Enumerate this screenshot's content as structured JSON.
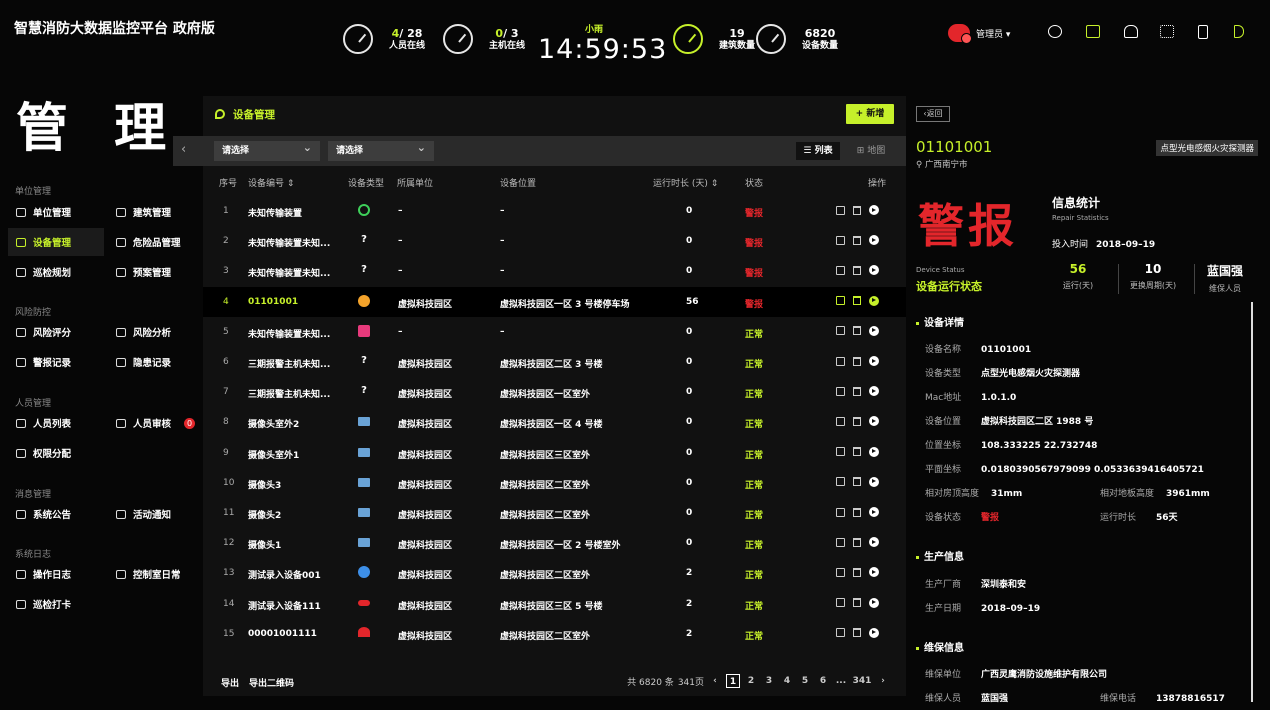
{
  "header": {
    "title": "智慧消防大数据监控平台 政府版",
    "stats": [
      {
        "current": "4",
        "total": "/ 28",
        "label": "人员在线"
      },
      {
        "current": "0",
        "total": "/ 3",
        "label": "主机在线"
      },
      {
        "value": "19",
        "label": "建筑数量"
      },
      {
        "value": "6820",
        "label": "设备数量"
      }
    ],
    "weather": "小雨",
    "time": "14:59:53",
    "admin": "管理员 ▾",
    "icons": [
      "chat-icon",
      "monitor-icon",
      "bell-icon",
      "grid-icon",
      "phone-icon",
      "speaker-icon"
    ]
  },
  "page_title": "管 理",
  "sidebar": {
    "sections": [
      {
        "title": "单位管理",
        "items": [
          [
            "单位管理",
            "建筑管理"
          ],
          [
            "设备管理",
            "危险品管理"
          ],
          [
            "巡检规划",
            "预案管理"
          ]
        ]
      },
      {
        "title": "风险防控",
        "items": [
          [
            "风险评分",
            "风险分析"
          ],
          [
            "警报记录",
            "隐患记录"
          ]
        ]
      },
      {
        "title": "人员管理",
        "items": [
          [
            "人员列表",
            "人员审核"
          ],
          [
            "权限分配",
            ""
          ]
        ]
      },
      {
        "title": "消息管理",
        "items": [
          [
            "系统公告",
            "活动通知"
          ]
        ]
      },
      {
        "title": "系统日志",
        "items": [
          [
            "操作日志",
            "控制室日常"
          ],
          [
            "巡检打卡",
            ""
          ]
        ]
      }
    ],
    "active": "设备管理",
    "badge": "0"
  },
  "panel": {
    "title": "设备管理",
    "add_label": "+ 新增",
    "filter1": "请选择",
    "filter2": "请选择",
    "view_list": "列表",
    "view_map": "地图",
    "columns": [
      "序号",
      "设备编号 ⇕",
      "设备类型",
      "所属单位",
      "设备位置",
      "运行时长 (天) ⇕",
      "状态",
      "操作"
    ],
    "rows": [
      {
        "no": "1",
        "code": "未知传输装置",
        "icon": "gcir",
        "unit": "–",
        "loc": "–",
        "dur": "0",
        "status": "警报"
      },
      {
        "no": "2",
        "code": "未知传输装置未知...",
        "icon": "q",
        "unit": "–",
        "loc": "–",
        "dur": "0",
        "status": "警报"
      },
      {
        "no": "3",
        "code": "未知传输装置未知...",
        "icon": "q",
        "unit": "–",
        "loc": "–",
        "dur": "0",
        "status": "警报"
      },
      {
        "no": "4",
        "code": "01101001",
        "icon": "orange",
        "unit": "虚拟科技园区",
        "loc": "虚拟科技园区一区 3 号楼停车场",
        "dur": "56",
        "status": "警报"
      },
      {
        "no": "5",
        "code": "未知传输装置未知...",
        "icon": "pink",
        "unit": "–",
        "loc": "–",
        "dur": "0",
        "status": "正常"
      },
      {
        "no": "6",
        "code": "三期报警主机未知...",
        "icon": "q",
        "unit": "虚拟科技园区",
        "loc": "虚拟科技园区二区 3 号楼",
        "dur": "0",
        "status": "正常"
      },
      {
        "no": "7",
        "code": "三期报警主机未知...",
        "icon": "q",
        "unit": "虚拟科技园区",
        "loc": "虚拟科技园区一区室外",
        "dur": "0",
        "status": "正常"
      },
      {
        "no": "8",
        "code": "摄像头室外2",
        "icon": "cam",
        "unit": "虚拟科技园区",
        "loc": "虚拟科技园区一区 4 号楼",
        "dur": "0",
        "status": "正常"
      },
      {
        "no": "9",
        "code": "摄像头室外1",
        "icon": "cam",
        "unit": "虚拟科技园区",
        "loc": "虚拟科技园区三区室外",
        "dur": "0",
        "status": "正常"
      },
      {
        "no": "10",
        "code": "摄像头3",
        "icon": "cam",
        "unit": "虚拟科技园区",
        "loc": "虚拟科技园区二区室外",
        "dur": "0",
        "status": "正常"
      },
      {
        "no": "11",
        "code": "摄像头2",
        "icon": "cam",
        "unit": "虚拟科技园区",
        "loc": "虚拟科技园区二区室外",
        "dur": "0",
        "status": "正常"
      },
      {
        "no": "12",
        "code": "摄像头1",
        "icon": "cam",
        "unit": "虚拟科技园区",
        "loc": "虚拟科技园区一区 2 号楼室外",
        "dur": "0",
        "status": "正常"
      },
      {
        "no": "13",
        "code": "测试录入设备001",
        "icon": "blue",
        "unit": "虚拟科技园区",
        "loc": "虚拟科技园区二区室外",
        "dur": "2",
        "status": "正常"
      },
      {
        "no": "14",
        "code": "测试录入设备111",
        "icon": "red",
        "unit": "虚拟科技园区",
        "loc": "虚拟科技园区三区 5 号楼",
        "dur": "2",
        "status": "正常"
      },
      {
        "no": "15",
        "code": "00001001111",
        "icon": "redc",
        "unit": "虚拟科技园区",
        "loc": "虚拟科技园区二区室外",
        "dur": "2",
        "status": "正常"
      }
    ],
    "footer": {
      "export": "导出",
      "export_qr": "导出二维码",
      "total": "共 6820 条",
      "pages": "341页",
      "page_nums": [
        "1",
        "2",
        "3",
        "4",
        "5",
        "6",
        "...",
        "341"
      ]
    }
  },
  "detail": {
    "back": "返回",
    "id": "01101001",
    "location": "广西南宁市",
    "type": "点型光电感烟火灾探测器",
    "status_big": "警报",
    "stats_title": "信息统计",
    "stats_sub": "Repair Statistics",
    "invest_label": "投入时间",
    "invest_date": "2018–09–19",
    "ds_en": "Device Status",
    "ds_cn": "设备运行状态",
    "kpis": [
      {
        "v": "56",
        "l": "运行(天)"
      },
      {
        "v": "10",
        "l": "更换周期(天)"
      },
      {
        "v": "蓝国强",
        "l": "维保人员"
      }
    ],
    "sec_device": "设备详情",
    "device": {
      "name_k": "设备名称",
      "name_v": "01101001",
      "type_k": "设备类型",
      "type_v": "点型光电感烟火灾探测器",
      "mac_k": "Mac地址",
      "mac_v": "1.0.1.0",
      "pos_k": "设备位置",
      "pos_v": "虚拟科技园区二区 1988 号",
      "coord_k": "位置坐标",
      "coord_v": "108.333225   22.732748",
      "plane_k": "平面坐标",
      "plane_v": "0.0180390567979099   0.0533639416405721",
      "roof_k": "相对房顶高度",
      "roof_v": "31mm",
      "floor_k": "相对地板高度",
      "floor_v": "3961mm",
      "state_k": "设备状态",
      "state_v": "警报",
      "run_k": "运行时长",
      "run_v": "56天"
    },
    "sec_prod": "生产信息",
    "prod": {
      "mfr_k": "生产厂商",
      "mfr_v": "深圳泰和安",
      "date_k": "生产日期",
      "date_v": "2018–09–19"
    },
    "sec_maint": "维保信息",
    "maint": {
      "unit_k": "维保单位",
      "unit_v": "广西灵鹰消防设施维护有限公司",
      "person_k": "维保人员",
      "person_v": "蓝国强",
      "phone_k": "维保电话",
      "phone_v": "13878816517"
    }
  },
  "colors": {
    "accent": "#c6f02a",
    "alarm": "#e3262b",
    "bg": "#060606"
  }
}
